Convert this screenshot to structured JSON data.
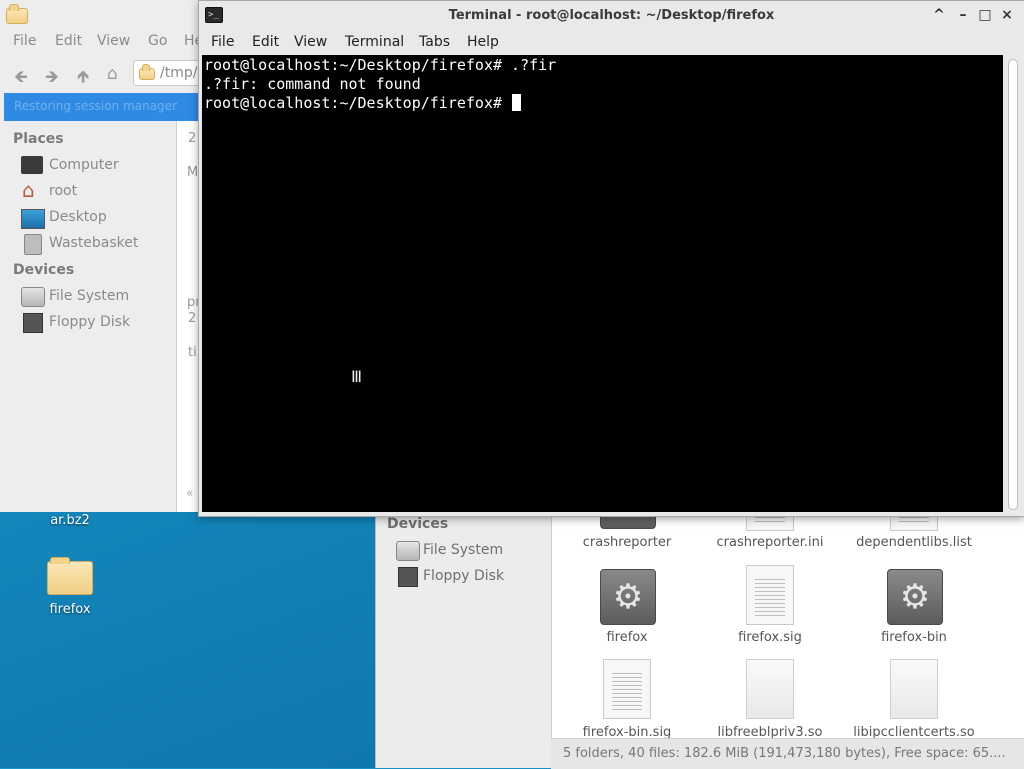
{
  "desktop": {
    "icons": [
      {
        "label": "ar.bz2"
      },
      {
        "label": "firefox"
      }
    ]
  },
  "file_manager_back": {
    "menu": [
      "File",
      "Edit",
      "View",
      "Go",
      "He"
    ],
    "path_value": "/tmp/",
    "selected_row_text": "Restoring session manager",
    "places_heading": "Places",
    "places": [
      "Computer",
      "root",
      "Desktop",
      "Wastebasket"
    ],
    "devices_heading": "Devices",
    "devices": [
      "File System",
      "Floppy Disk"
    ],
    "pane_fragments": [
      "2",
      "M",
      "pr",
      "2",
      "ti",
      "«"
    ]
  },
  "file_manager_front": {
    "devices_heading": "Devices",
    "devices": [
      "File System",
      "Floppy Disk"
    ],
    "files": [
      {
        "name": "crashreporter",
        "icon": "gear-icon"
      },
      {
        "name": "crashreporter.ini",
        "icon": "text-file-icon"
      },
      {
        "name": "dependentlibs.list",
        "icon": "text-file-icon"
      },
      {
        "name": "firefox",
        "icon": "gear-icon"
      },
      {
        "name": "firefox.sig",
        "icon": "text-file-icon"
      },
      {
        "name": "firefox-bin",
        "icon": "gear-icon"
      },
      {
        "name": "firefox-bin.sig",
        "icon": "text-file-icon"
      },
      {
        "name": "libfreeblpriv3.so",
        "icon": "library-file-icon"
      },
      {
        "name": "libipcclientcerts.so",
        "icon": "library-file-icon"
      }
    ],
    "status": "5 folders, 40 files: 182.6 MiB (191,473,180 bytes), Free space: 65...."
  },
  "terminal": {
    "title": "Terminal - root@localhost: ~/Desktop/firefox",
    "menu": [
      "File",
      "Edit",
      "View",
      "Terminal",
      "Tabs",
      "Help"
    ],
    "lines": [
      "root@localhost:~/Desktop/firefox# .?fir",
      ".?fir: command not found",
      "root@localhost:~/Desktop/firefox# "
    ],
    "window_buttons": [
      "^",
      "–",
      "□",
      "×"
    ]
  }
}
